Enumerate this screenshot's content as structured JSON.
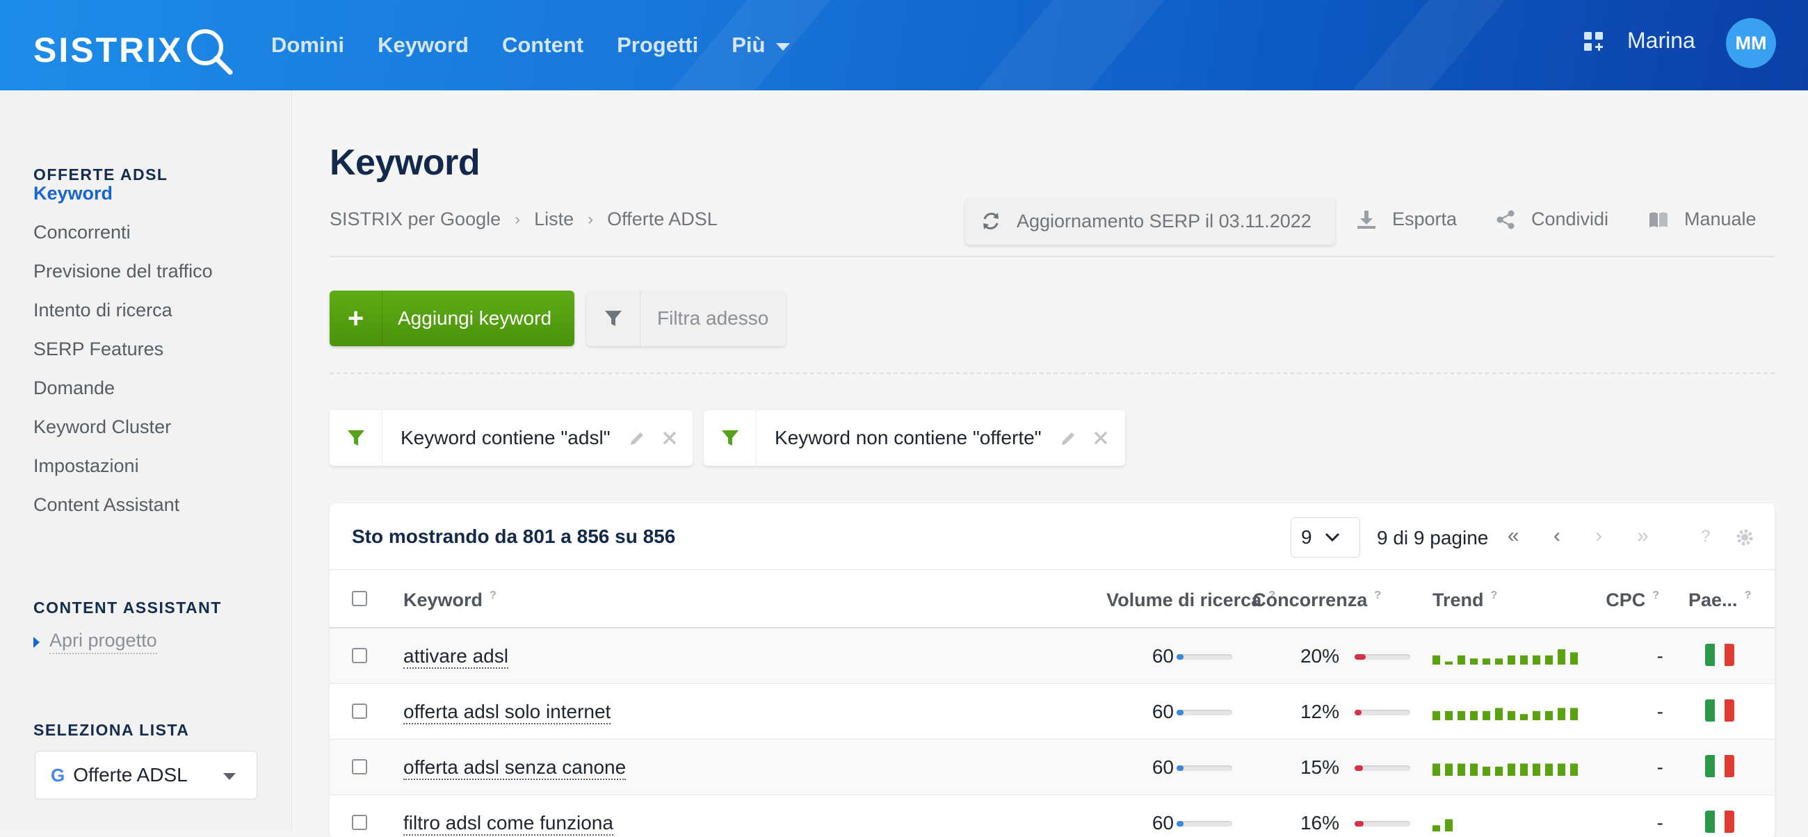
{
  "app": {
    "logo_text": "SISTRIX",
    "nav": [
      {
        "label": "Domini"
      },
      {
        "label": "Keyword"
      },
      {
        "label": "Content"
      },
      {
        "label": "Progetti"
      },
      {
        "label": "Più"
      }
    ],
    "user_name": "Marina",
    "avatar_initials": "MM",
    "colors": {
      "brand_blue": "#1976d9",
      "green": "#4f9a0c",
      "accent_link": "#1766d0"
    }
  },
  "sidebar": {
    "section1_title": "OFFERTE ADSL",
    "items": [
      {
        "label": "Keyword",
        "active": true
      },
      {
        "label": "Concorrenti"
      },
      {
        "label": "Previsione del traffico"
      },
      {
        "label": "Intento di ricerca"
      },
      {
        "label": "SERP Features"
      },
      {
        "label": "Domande"
      },
      {
        "label": "Keyword Cluster"
      },
      {
        "label": "Impostazioni"
      },
      {
        "label": "Content Assistant"
      }
    ],
    "section2_title": "CONTENT ASSISTANT",
    "open_project": "Apri progetto",
    "section3_title": "SELEZIONA LISTA",
    "list_select_value": "Offerte ADSL"
  },
  "main": {
    "title": "Keyword",
    "breadcrumb": [
      "SISTRIX per Google",
      "Liste",
      "Offerte ADSL"
    ],
    "serp_update": "Aggiornamento SERP il 03.11.2022",
    "tools": {
      "export": "Esporta",
      "share": "Condividi",
      "manual": "Manuale"
    },
    "add_keyword": "Aggiungi keyword",
    "filter_now": "Filtra adesso",
    "filters": [
      "Keyword contiene \"adsl\"",
      "Keyword non contiene \"offerte\""
    ]
  },
  "table": {
    "showing": "Sto mostrando da 801 a 856 su 856",
    "page_value": "9",
    "pages_text": "9 di 9 pagine",
    "columns": {
      "keyword": "Keyword",
      "volume": "Volume di ricerca",
      "competition": "Concorrenza",
      "trend": "Trend",
      "cpc": "CPC",
      "country": "Pae..."
    },
    "rows": [
      {
        "keyword": "attivare adsl",
        "volume": "60",
        "volume_pct": 0.12,
        "competition": "20%",
        "competition_pct": 0.2,
        "trend": [
          3,
          1,
          3,
          2,
          2,
          2,
          3,
          3,
          3,
          3,
          5,
          4
        ],
        "cpc": "-"
      },
      {
        "keyword": "offerta adsl solo internet",
        "volume": "60",
        "volume_pct": 0.12,
        "competition": "12%",
        "competition_pct": 0.12,
        "trend": [
          3,
          3,
          3,
          3,
          3,
          4,
          3,
          2,
          3,
          3,
          4,
          4
        ],
        "cpc": "-"
      },
      {
        "keyword": "offerta adsl senza canone",
        "volume": "60",
        "volume_pct": 0.12,
        "competition": "15%",
        "competition_pct": 0.15,
        "trend": [
          4,
          4,
          4,
          4,
          3,
          3,
          4,
          4,
          4,
          4,
          4,
          4
        ],
        "cpc": "-"
      },
      {
        "keyword": "filtro adsl come funziona",
        "volume": "60",
        "volume_pct": 0.12,
        "competition": "16%",
        "competition_pct": 0.16,
        "trend": [
          2,
          4
        ],
        "cpc": "-"
      }
    ],
    "trend_max": 5
  }
}
